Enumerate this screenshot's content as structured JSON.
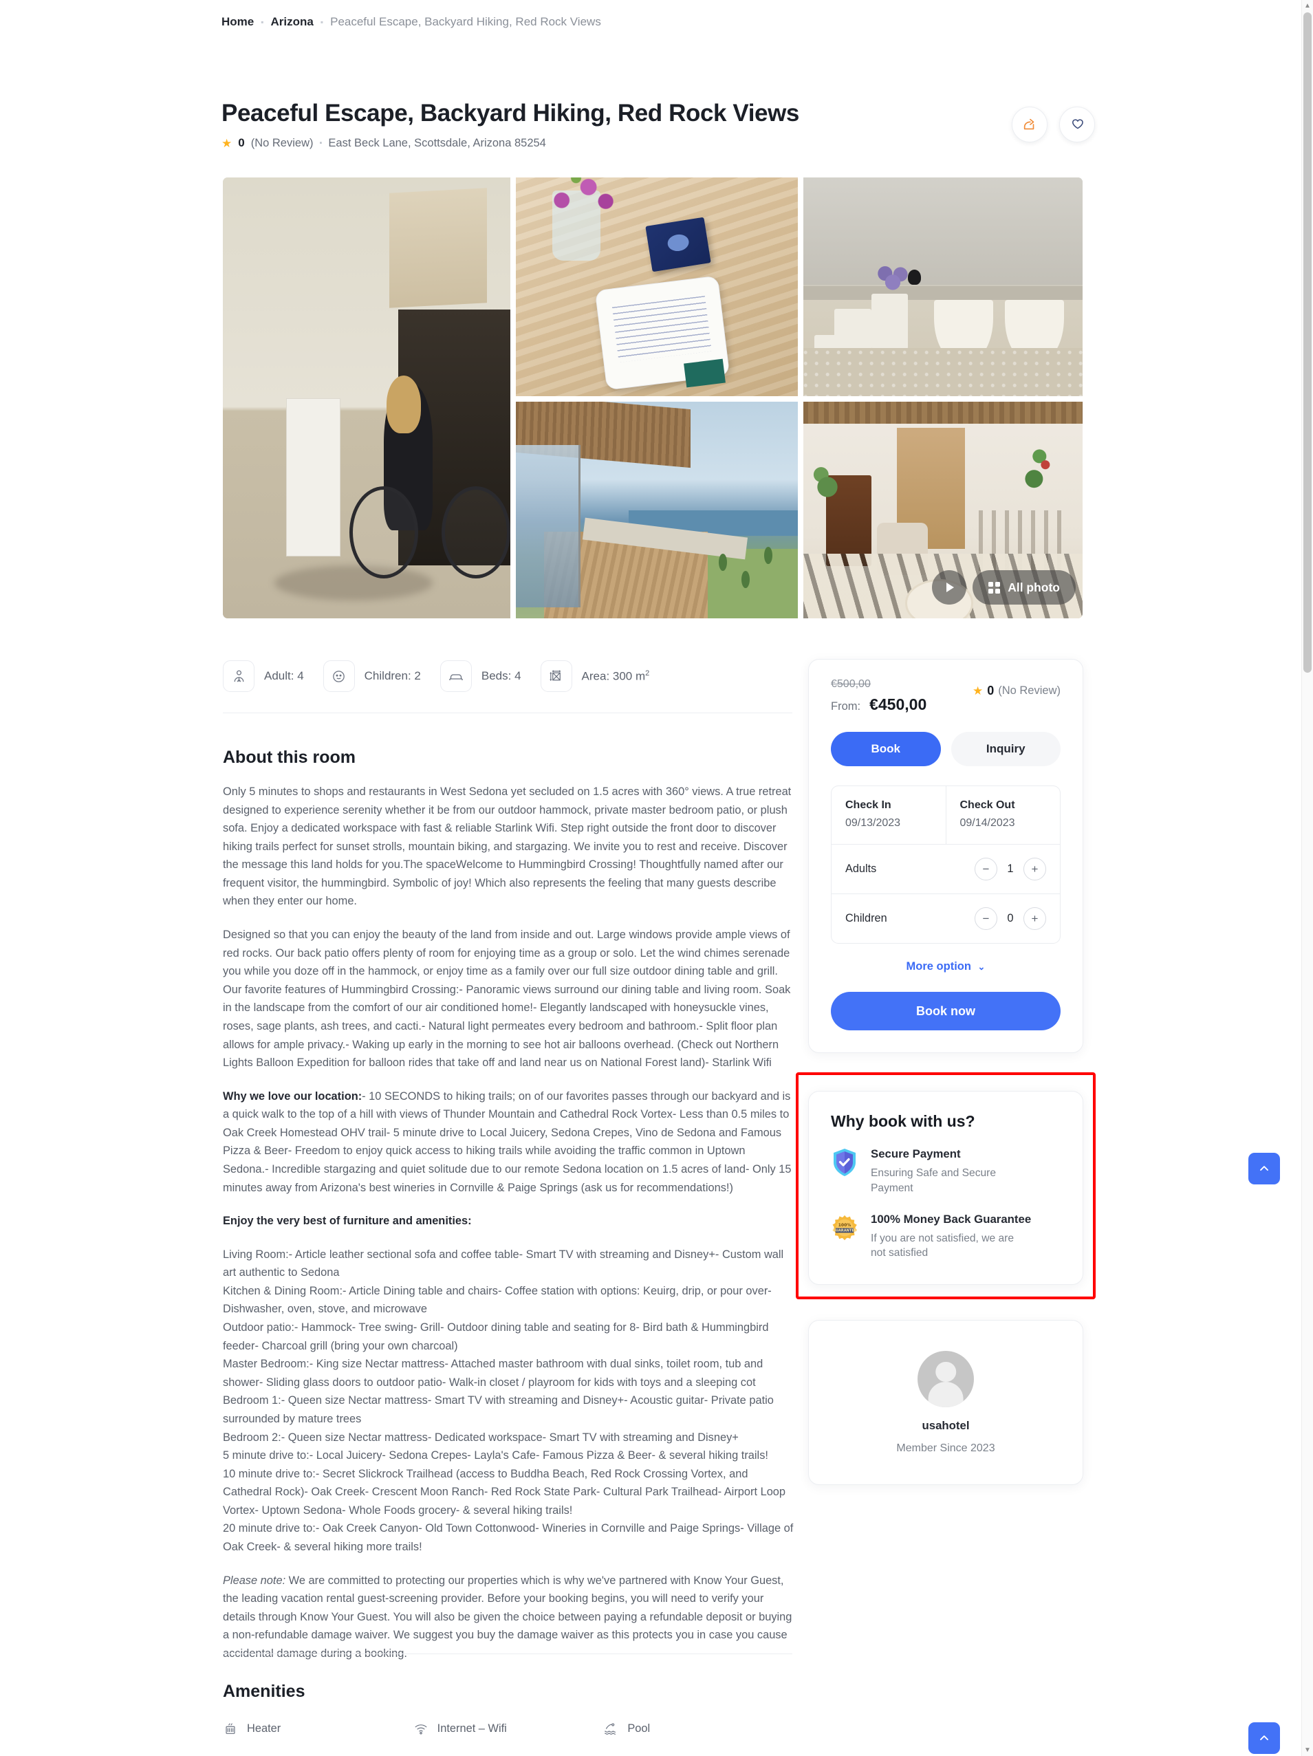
{
  "breadcrumb": {
    "home": "Home",
    "region": "Arizona",
    "current": "Peaceful Escape, Backyard Hiking, Red Rock Views"
  },
  "listing": {
    "title": "Peaceful Escape, Backyard Hiking, Red Rock Views",
    "rating": "0",
    "review_text": "(No Review)",
    "address": "East Beck Lane, Scottsdale, Arizona 85254"
  },
  "head_actions": {
    "share": "share-icon",
    "favorite": "heart-icon"
  },
  "gallery": {
    "play_label": "play-icon",
    "all_photo_label": "All photo"
  },
  "stats": [
    {
      "icon": "adult-icon",
      "label": "Adult: 4"
    },
    {
      "icon": "children-icon",
      "label": "Children: 2"
    },
    {
      "icon": "bed-icon",
      "label": "Beds: 4"
    },
    {
      "icon": "area-icon",
      "label": "Area: 300 m",
      "sup": "2"
    }
  ],
  "about": {
    "title": "About this room",
    "p1": "Only 5 minutes to shops and restaurants in West Sedona yet secluded on 1.5 acres with 360° views. A true retreat designed to experience serenity whether it be from our outdoor hammock, private master bedroom patio, or plush sofa. Enjoy a dedicated workspace with fast & reliable Starlink Wifi. Step right outside the front door to discover hiking trails perfect for sunset strolls, mountain biking, and stargazing. We invite you to rest and receive. Discover the message this land holds for you.The spaceWelcome to Hummingbird Crossing! Thoughtfully named after our frequent visitor, the hummingbird. Symbolic of joy! Which also represents the feeling that many guests describe when they enter our home.",
    "p2": "Designed so that you can enjoy the beauty of the land from inside and out. Large windows provide ample views of red rocks. Our back patio offers plenty of room for enjoying time as a group or solo. Let the wind chimes serenade you while you doze off in the hammock, or enjoy time as a family over our full size outdoor dining table and grill. Our favorite features of Hummingbird Crossing:- Panoramic views surround our dining table and living room. Soak in the landscape from the comfort of our air conditioned home!- Elegantly landscaped with honeysuckle vines, roses, sage plants, ash trees, and cacti.- Natural light permeates every bedroom and bathroom.- Split floor plan allows for ample privacy.- Waking up early in the morning to see hot air balloons overhead. (Check out Northern Lights Balloon Expedition for balloon rides that take off and land near us on National Forest land)- Starlink Wifi",
    "p3_bold": "Why we love our location:",
    "p3": "- 10 SECONDS to hiking trails; on of our favorites passes through our backyard and is a quick walk to the top of a hill with views of Thunder Mountain and Cathedral Rock Vortex- Less than 0.5 miles to Oak Creek Homestead OHV trail- 5 minute drive to Local Juicery, Sedona Crepes, Vino de Sedona and Famous Pizza & Beer- Freedom to enjoy quick access to hiking trails while avoiding the traffic common in Uptown Sedona.- Incredible stargazing and quiet solitude due to our remote Sedona location on 1.5 acres of land- Only 15 minutes away from Arizona's best wineries in Cornville & Paige Springs (ask us for recommendations!)",
    "p4_bold": "Enjoy the very best of furniture and amenities:",
    "p5": "Living Room:- Article leather sectional sofa and coffee table- Smart TV with streaming and Disney+- Custom wall art authentic to Sedona\nKitchen & Dining Room:- Article Dining table and chairs- Coffee station with options: Keuirg, drip, or pour over- Dishwasher, oven, stove, and microwave\nOutdoor patio:- Hammock- Tree swing- Grill- Outdoor dining table and seating for 8- Bird bath & Hummingbird feeder- Charcoal grill (bring your own charcoal)\nMaster Bedroom:- King size Nectar mattress- Attached master bathroom with dual sinks, toilet room, tub and shower- Sliding glass doors to outdoor patio- Walk-in closet / playroom for kids with toys and a sleeping cot\nBedroom 1:- Queen size Nectar mattress- Smart TV with streaming and Disney+- Acoustic guitar- Private patio surrounded by mature trees\nBedroom 2:- Queen size Nectar mattress- Dedicated workspace- Smart TV with streaming and Disney+\n5 minute drive to:- Local Juicery- Sedona Crepes- Layla's Cafe- Famous Pizza & Beer- & several hiking trails!\n10 minute drive to:- Secret Slickrock Trailhead (access to Buddha Beach, Red Rock Crossing Vortex, and Cathedral Rock)- Oak Creek- Crescent Moon Ranch- Red Rock State Park- Cultural Park Trailhead- Airport Loop Vortex- Uptown Sedona- Whole Foods grocery- & several hiking trails!\n20 minute drive to:- Oak Creek Canyon- Old Town Cottonwood- Wineries in Cornville and Paige Springs- Village of Oak Creek- & several hiking more trails!",
    "p6_italic": "Please note:",
    "p6": " We are committed to protecting our properties which is why we've partnered with Know Your Guest, the leading vacation rental guest-screening provider. Before your booking begins, you will need to verify your details through Know Your Guest. You will also be given the choice between paying a refundable deposit or buying a non-refundable damage waiver. We suggest you buy the damage waiver as this protects you in case you cause accidental damage during a booking."
  },
  "amenities": {
    "title": "Amenities",
    "items": [
      {
        "icon": "heater-icon",
        "label": "Heater"
      },
      {
        "icon": "wifi-icon",
        "label": "Internet – Wifi"
      },
      {
        "icon": "pool-icon",
        "label": "Pool"
      }
    ]
  },
  "booking": {
    "old_price": "€500,00",
    "from_label": "From:",
    "new_price": "€450,00",
    "rating": "0",
    "review_text": "(No Review)",
    "tab_book": "Book",
    "tab_inquiry": "Inquiry",
    "check_in_label": "Check In",
    "check_in_value": "09/13/2023",
    "check_out_label": "Check Out",
    "check_out_value": "09/14/2023",
    "adults_label": "Adults",
    "adults_value": "1",
    "children_label": "Children",
    "children_value": "0",
    "more_option": "More option",
    "book_now": "Book now",
    "minus": "−",
    "plus": "+"
  },
  "why_book": {
    "title": "Why book with us?",
    "items": [
      {
        "icon": "shield-check-icon",
        "heading": "Secure Payment",
        "text": "Ensuring Safe and Secure Payment"
      },
      {
        "icon": "guarantee-badge-icon",
        "heading": "100% Money Back Guarantee",
        "text": "If you are not satisfied, we are not satisfied"
      }
    ]
  },
  "host": {
    "avatar": "avatar-placeholder-icon",
    "name": "usahotel",
    "member_since": "Member Since 2023"
  },
  "floating": {
    "scroll_top": "chevron-up-icon"
  },
  "colors": {
    "accent": "#4372f7",
    "accent_dark": "#3b6bf5",
    "star": "#ffb31f",
    "highlight_box": "#ff0000",
    "text": "#2b2f38",
    "muted": "#7a808a"
  }
}
